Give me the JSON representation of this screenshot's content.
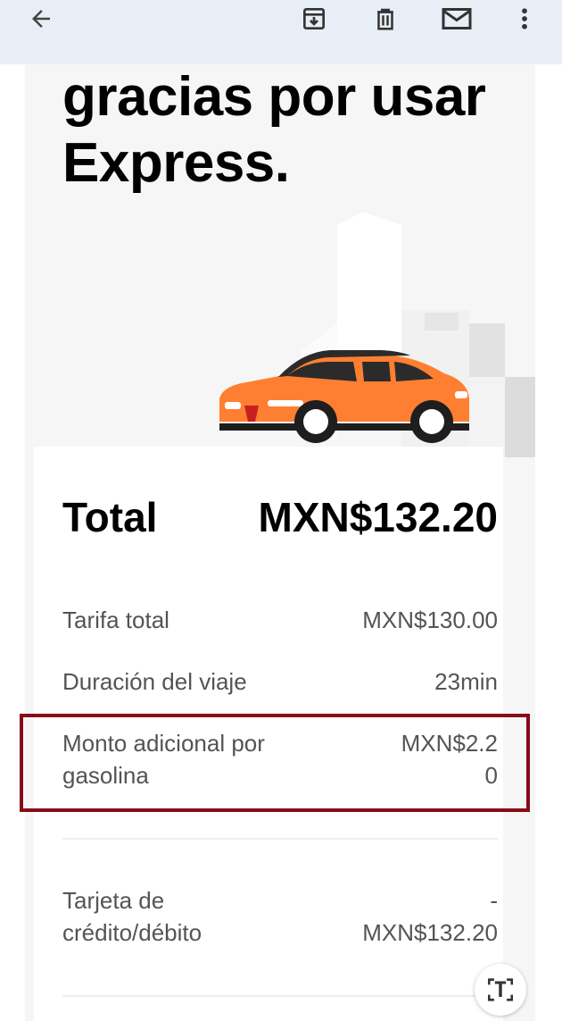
{
  "toolbar": {
    "back_icon": "arrow-left-icon",
    "archive_icon": "archive-icon",
    "delete_icon": "trash-icon",
    "mail_icon": "mail-icon",
    "more_icon": "more-vert-icon"
  },
  "hero": {
    "line1": "gracias por usar",
    "line2": "Express."
  },
  "receipt": {
    "total_label": "Total",
    "total_value": "MXN$132.20",
    "rows": [
      {
        "label": "Tarifa total",
        "value": "MXN$130.00"
      },
      {
        "label": "Duración del viaje",
        "value": "23min"
      },
      {
        "label_line1": "Monto adicional por",
        "label_line2": "gasolina",
        "value_line1": "MXN$2.2",
        "value_line2": "0"
      }
    ],
    "payment": {
      "label_line1": "Tarjeta de",
      "label_line2": "crédito/débito",
      "value_line1": "-",
      "value_line2": "MXN$132.20"
    }
  },
  "fab": {
    "label": "T",
    "icon": "text-scan-icon"
  },
  "colors": {
    "toolbar_bg": "#e8eef6",
    "car": "#ff7f32",
    "highlight_border": "#8b0a16"
  }
}
